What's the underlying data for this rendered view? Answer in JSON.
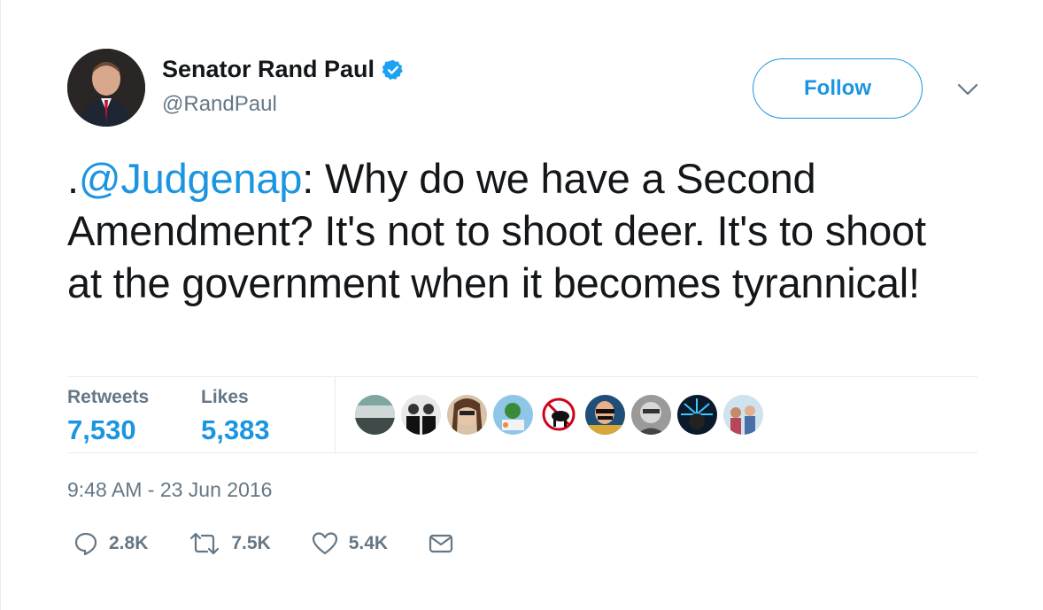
{
  "author": {
    "display_name": "Senator Rand Paul",
    "handle": "@RandPaul",
    "verified": true
  },
  "follow_button": {
    "label": "Follow"
  },
  "tweet": {
    "text_prefix": ".",
    "mention": "@Judgenap",
    "text_body": ": Why do we have a Second Amendment? It's not to shoot deer. It's to shoot at the government when it becomes tyrannical!"
  },
  "stats": {
    "retweets_label": "Retweets",
    "retweets_value": "7,530",
    "likes_label": "Likes",
    "likes_value": "5,383"
  },
  "timestamp": "9:48 AM - 23 Jun 2016",
  "actions": {
    "reply_count": "2.8K",
    "retweet_count": "7.5K",
    "like_count": "5.4K"
  },
  "colors": {
    "accent": "#1b95e0",
    "text_primary": "#14171a",
    "text_secondary": "#657786",
    "divider": "#e6ecf0"
  },
  "icons": [
    "verified-badge-icon",
    "chevron-down-icon",
    "reply-icon",
    "retweet-icon",
    "heart-icon",
    "direct-message-icon"
  ]
}
